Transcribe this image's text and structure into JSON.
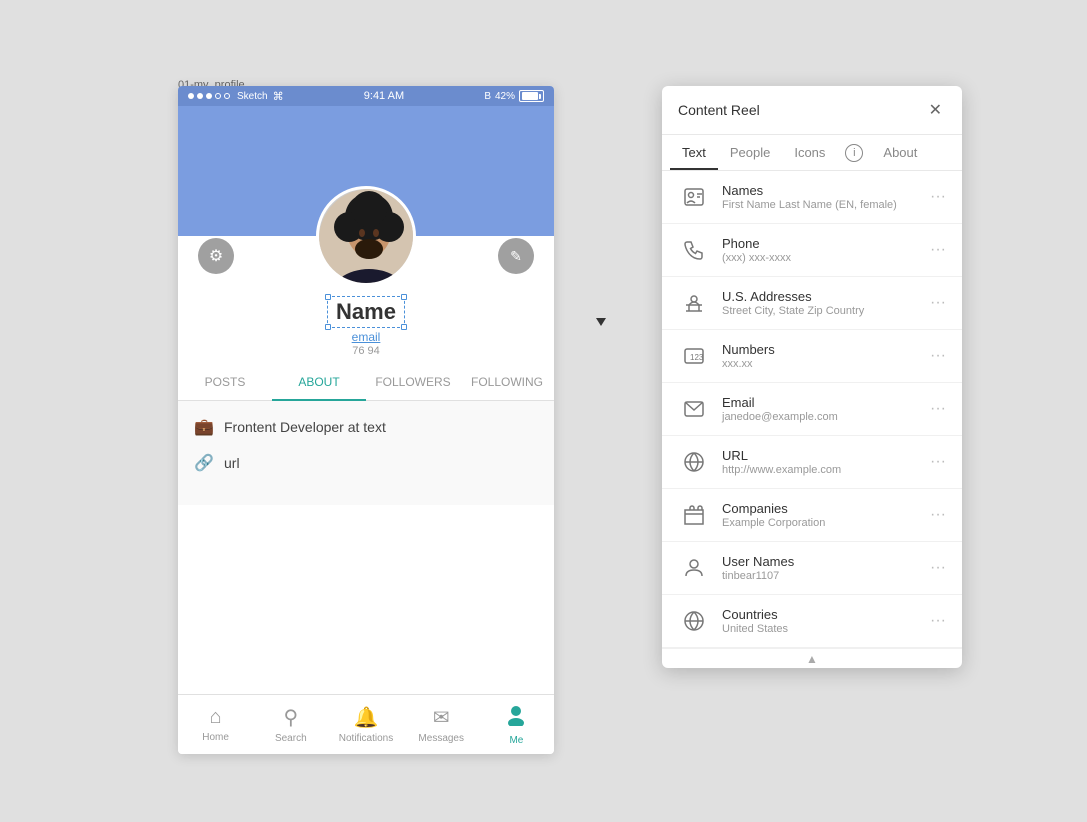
{
  "file_label": "01-my_profile",
  "status_bar": {
    "dots": [
      "filled",
      "filled",
      "filled",
      "empty",
      "empty"
    ],
    "app": "Sketch",
    "time": "9:41 AM",
    "bluetooth": "B",
    "battery_pct": "42%"
  },
  "profile": {
    "name": "Name",
    "email": "email",
    "stats": "76 94",
    "settings_icon": "⚙",
    "edit_icon": "✎"
  },
  "tabs": [
    {
      "label": "POSTS",
      "active": false
    },
    {
      "label": "ABOUT",
      "active": true
    },
    {
      "label": "FOLLOWERS",
      "active": false
    },
    {
      "label": "FOLLOWING",
      "active": false
    }
  ],
  "about_items": [
    {
      "icon": "💼",
      "text": "Frontent Developer at text"
    },
    {
      "icon": "🔗",
      "text": "url"
    }
  ],
  "bottom_nav": [
    {
      "label": "Home",
      "icon": "⌂",
      "active": false
    },
    {
      "label": "Search",
      "icon": "⚲",
      "active": false
    },
    {
      "label": "Notifications",
      "icon": "🔔",
      "active": false
    },
    {
      "label": "Messages",
      "icon": "✉",
      "active": false
    },
    {
      "label": "Me",
      "icon": "●",
      "active": true
    }
  ],
  "content_reel": {
    "title": "Content Reel",
    "tabs": [
      {
        "label": "Text",
        "active": true
      },
      {
        "label": "People",
        "active": false
      },
      {
        "label": "Icons",
        "active": false
      },
      {
        "label": "info",
        "active": false,
        "is_icon": true
      },
      {
        "label": "About",
        "active": false
      }
    ],
    "items": [
      {
        "icon": "person_card",
        "title": "Names",
        "subtitle": "First Name Last Name (EN, female)",
        "more": "···"
      },
      {
        "icon": "phone",
        "title": "Phone",
        "subtitle": "(xxx) xxx-xxxx",
        "more": "···"
      },
      {
        "icon": "person_lines",
        "title": "U.S. Addresses",
        "subtitle": "Street City, State Zip Country",
        "more": "···"
      },
      {
        "icon": "numbers",
        "title": "Numbers",
        "subtitle": "xxx.xx",
        "more": "···"
      },
      {
        "icon": "envelope",
        "title": "Email",
        "subtitle": "janedoe@example.com",
        "more": "···"
      },
      {
        "icon": "circle_dash",
        "title": "URL",
        "subtitle": "http://www.example.com",
        "more": "···"
      },
      {
        "icon": "briefcase",
        "title": "Companies",
        "subtitle": "Example Corporation",
        "more": "···"
      },
      {
        "icon": "person",
        "title": "User Names",
        "subtitle": "tinbear1107",
        "more": "···"
      },
      {
        "icon": "globe",
        "title": "Countries",
        "subtitle": "United States",
        "more": "···"
      }
    ]
  }
}
